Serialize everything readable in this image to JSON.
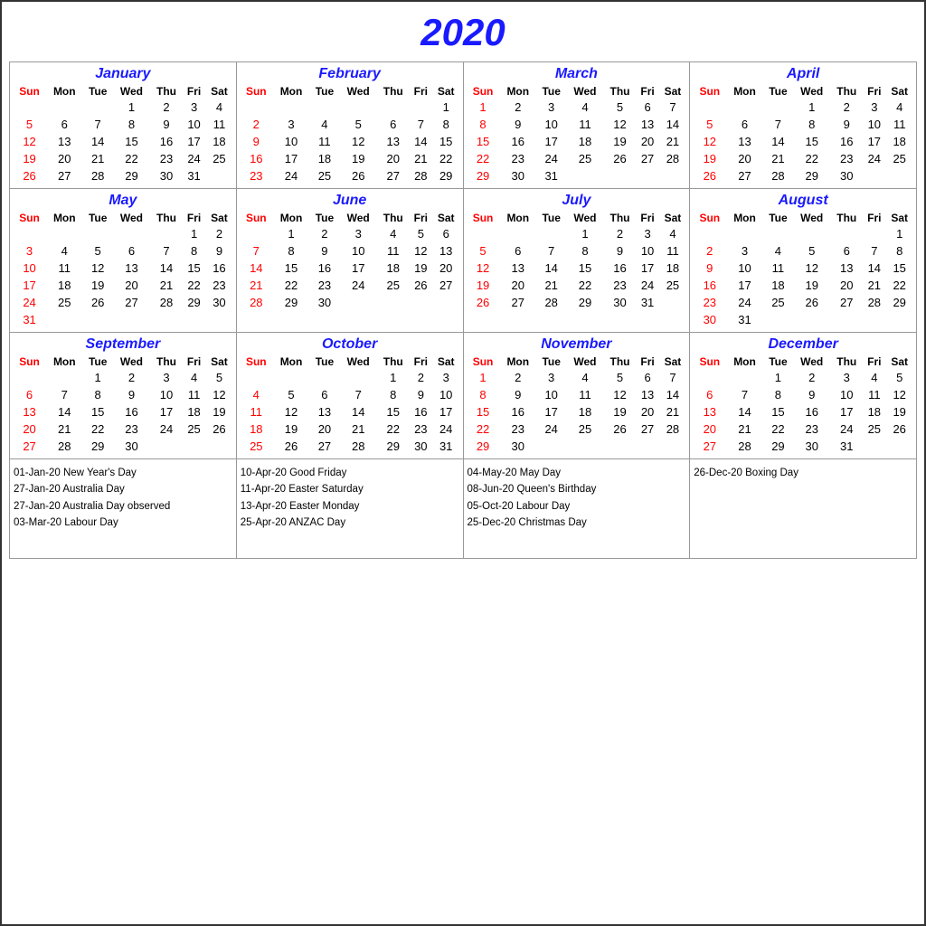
{
  "title": "2020",
  "months": [
    {
      "name": "January",
      "startDay": 3,
      "days": 31,
      "sundays": [
        5,
        12,
        19,
        26
      ]
    },
    {
      "name": "February",
      "startDay": 6,
      "days": 29,
      "sundays": [
        2,
        9,
        16,
        23
      ]
    },
    {
      "name": "March",
      "startDay": 0,
      "days": 31,
      "sundays": [
        1,
        8,
        15,
        22,
        29
      ]
    },
    {
      "name": "April",
      "startDay": 3,
      "days": 30,
      "sundays": [
        5,
        12,
        19,
        26
      ]
    },
    {
      "name": "May",
      "startDay": 5,
      "days": 31,
      "sundays": [
        3,
        10,
        17,
        24,
        31
      ]
    },
    {
      "name": "June",
      "startDay": 1,
      "days": 30,
      "sundays": [
        7,
        14,
        21,
        28
      ]
    },
    {
      "name": "July",
      "startDay": 3,
      "days": 31,
      "sundays": [
        5,
        12,
        19,
        26
      ]
    },
    {
      "name": "August",
      "startDay": 6,
      "days": 31,
      "sundays": [
        2,
        9,
        16,
        23,
        30
      ]
    },
    {
      "name": "September",
      "startDay": 2,
      "days": 30,
      "sundays": [
        6,
        13,
        20,
        27
      ]
    },
    {
      "name": "October",
      "startDay": 4,
      "days": 31,
      "sundays": [
        4,
        11,
        18,
        25
      ]
    },
    {
      "name": "November",
      "startDay": 0,
      "days": 30,
      "sundays": [
        1,
        8,
        15,
        22,
        29
      ]
    },
    {
      "name": "December",
      "startDay": 2,
      "days": 31,
      "sundays": [
        6,
        13,
        20,
        27
      ]
    }
  ],
  "holidays": [
    {
      "col": 0,
      "items": [
        "01-Jan-20 New Year's Day",
        "27-Jan-20 Australia Day",
        "27-Jan-20 Australia Day observed",
        "03-Mar-20 Labour Day"
      ]
    },
    {
      "col": 1,
      "items": [
        "10-Apr-20 Good Friday",
        "11-Apr-20 Easter Saturday",
        "13-Apr-20 Easter Monday",
        "25-Apr-20 ANZAC Day"
      ]
    },
    {
      "col": 2,
      "items": [
        "04-May-20 May Day",
        "08-Jun-20 Queen's Birthday",
        "05-Oct-20 Labour Day",
        "25-Dec-20 Christmas Day"
      ]
    },
    {
      "col": 3,
      "items": [
        "26-Dec-20 Boxing Day"
      ]
    }
  ]
}
